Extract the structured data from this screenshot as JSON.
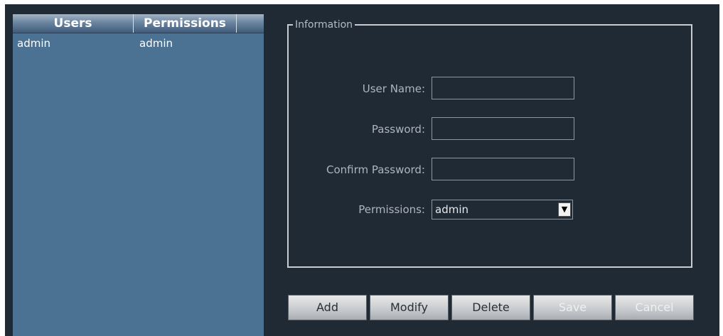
{
  "user_list": {
    "columns": [
      "Users",
      "Permissions"
    ],
    "rows": [
      {
        "user": "admin",
        "permission": "admin"
      }
    ]
  },
  "info": {
    "legend": "Information",
    "user_name_label": "User Name:",
    "password_label": "Password:",
    "confirm_password_label": "Confirm Password:",
    "permissions_label": "Permissions:",
    "permissions_value": "admin",
    "user_name_value": "",
    "password_value": "",
    "confirm_password_value": ""
  },
  "buttons": {
    "add": "Add",
    "modify": "Modify",
    "delete": "Delete",
    "save": "Save",
    "cancel": "Cancel"
  },
  "icons": {
    "dropdown": "triangle-down-icon"
  },
  "colors": {
    "background": "#1f2a35",
    "list_background": "#4b7193"
  }
}
